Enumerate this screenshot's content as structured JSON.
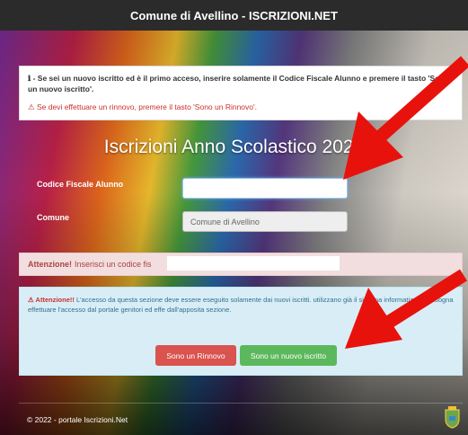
{
  "app_title": "Comune di Avellino - ISCRIZIONI.NET",
  "info": {
    "line1": "ℹ - Se sei un nuovo iscritto ed è il primo acceso, inserire solamente il Codice Fiscale Alunno e premere il tasto 'Sono un nuovo iscritto'.",
    "warning": "⚠ Se devi effettuare un rinnovo, premere il tasto 'Sono un Rinnovo'."
  },
  "page_title": "Iscrizioni Anno Scolastico 2022",
  "form": {
    "codice_label": "Codice Fiscale Alunno",
    "codice_value": "",
    "comune_label": "Comune",
    "comune_value": "Comune di Avellino"
  },
  "alert": {
    "strong": "Attenzione!",
    "text": "Inserisci un codice fis"
  },
  "notice": {
    "strong": "⚠ Attenzione!!",
    "text": "L'accesso da questa sezione deve essere eseguito solamente dai nuovi iscritti. utilizzano già il sistema informatizzato, bisogna effettuare l'accesso dal portale genitori ed effe dall'apposita sezione."
  },
  "buttons": {
    "rinnovo": "Sono un Rinnovo",
    "nuovo": "Sono un nuovo iscritto"
  },
  "footer": "© 2022 - portale Iscrizioni.Net",
  "colors": {
    "rinnovo": "#d9534f",
    "nuovo": "#5cb85c",
    "arrow": "#e8120c"
  }
}
